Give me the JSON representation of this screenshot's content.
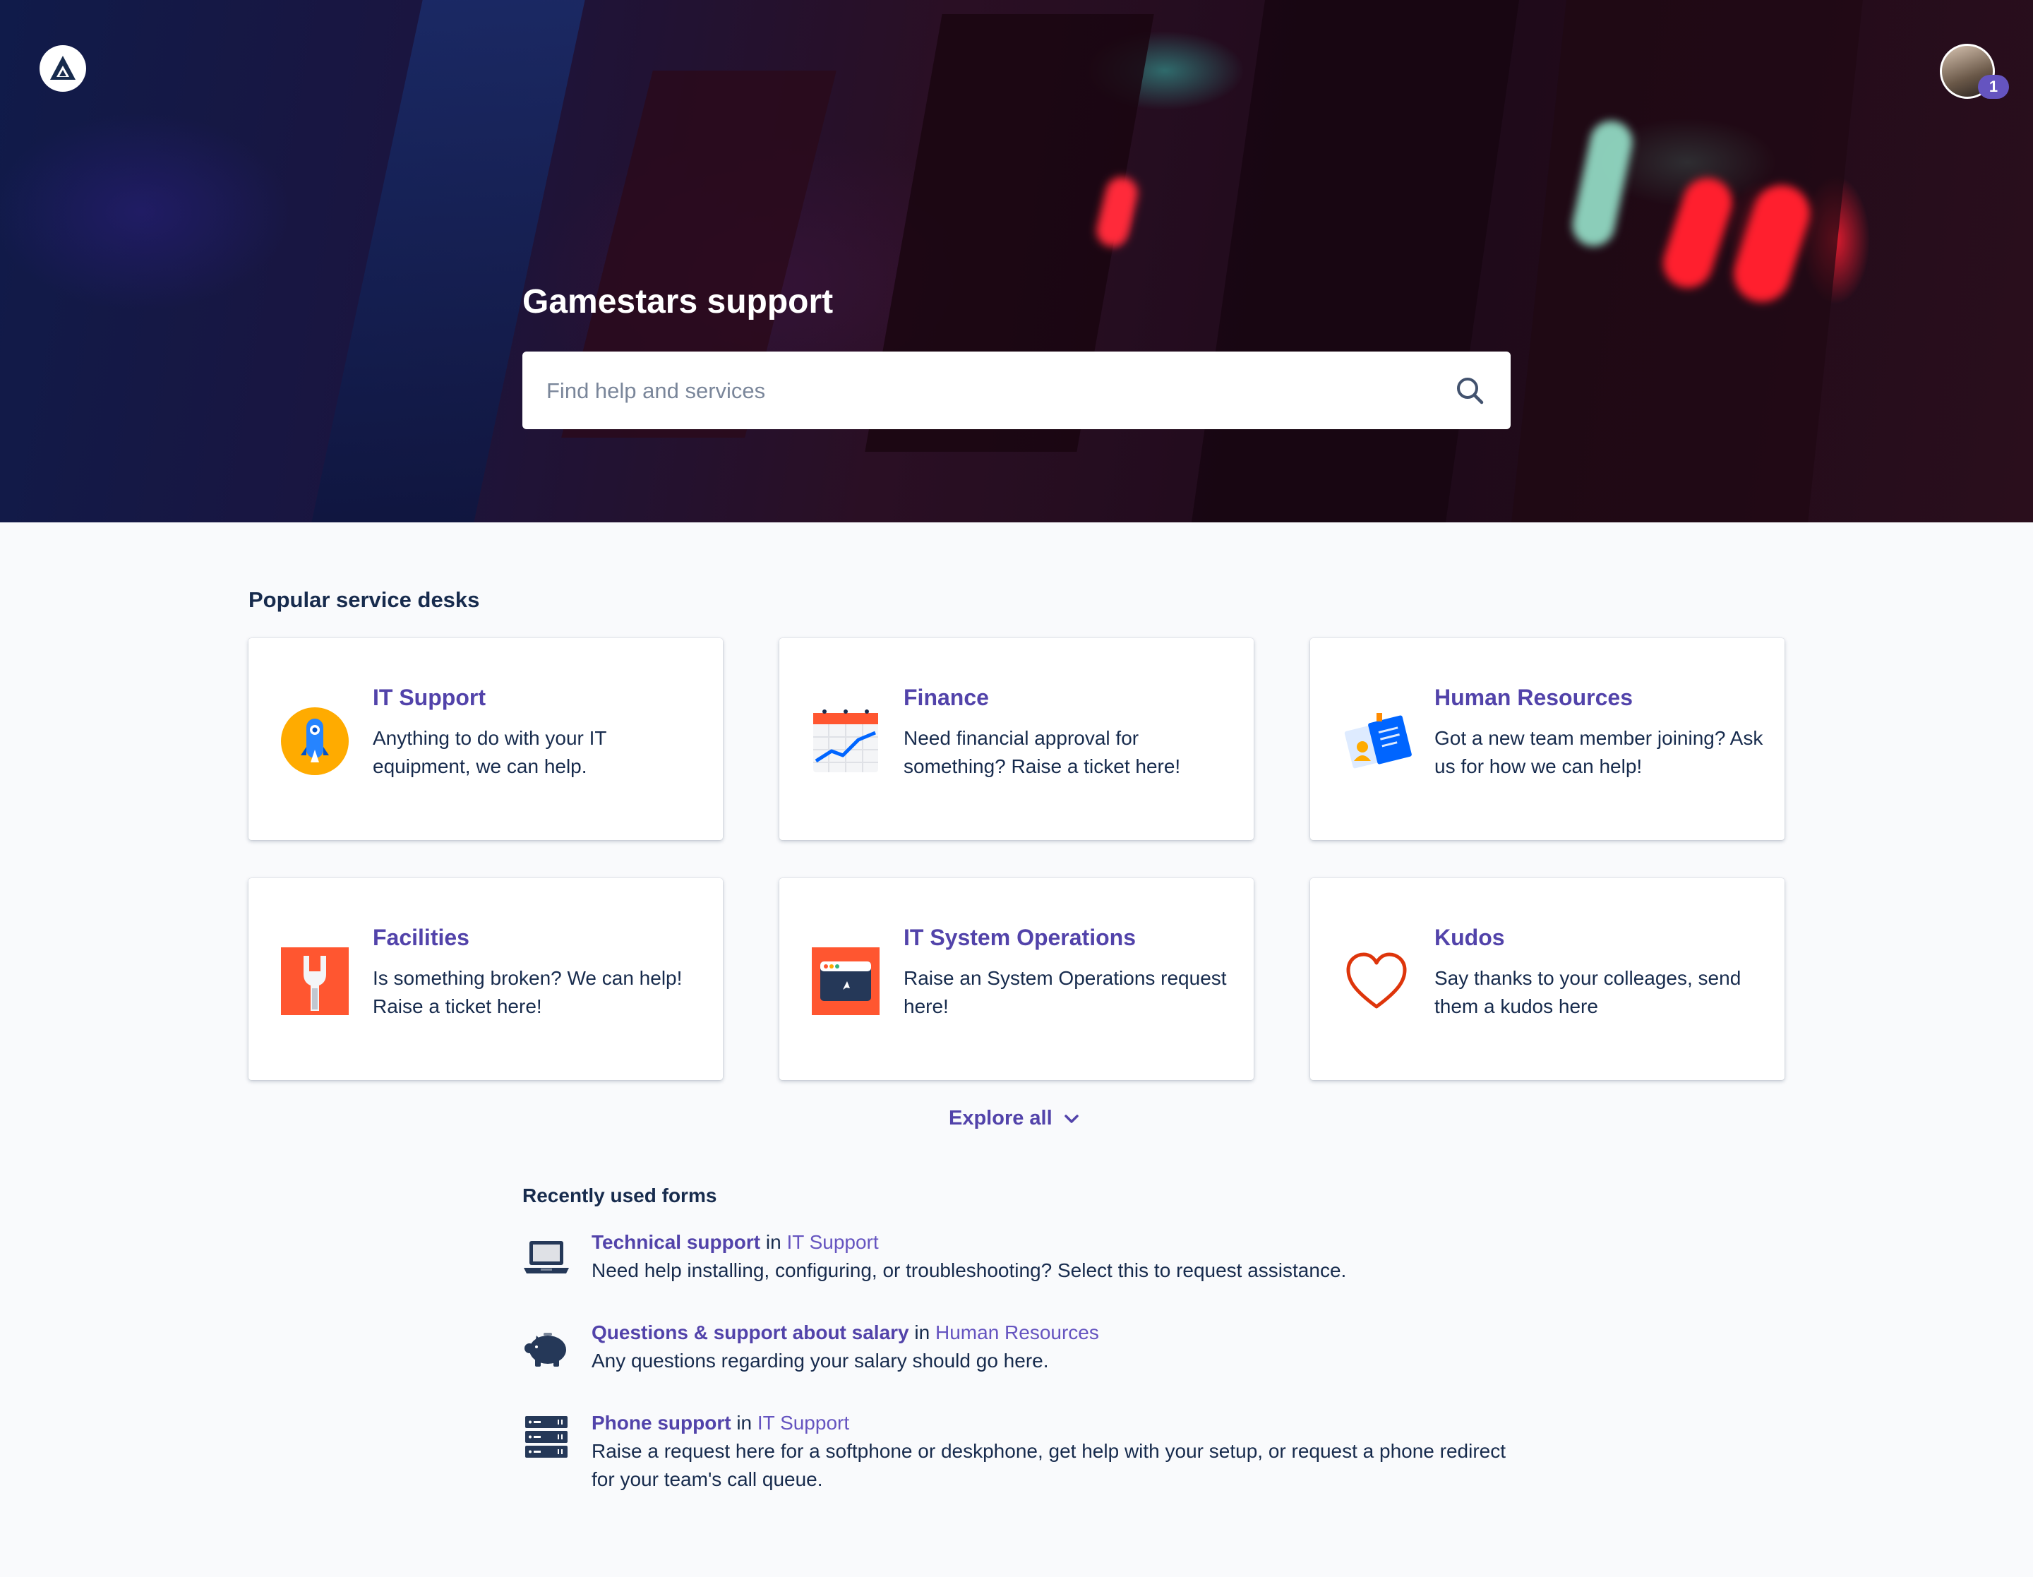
{
  "portal": {
    "title": "Gamestars support",
    "search_placeholder": "Find help and services",
    "notification_count": "1"
  },
  "popular": {
    "heading": "Popular service desks",
    "desks": [
      {
        "title": "IT Support",
        "description": "Anything to do with your IT equipment, we can help.",
        "icon": "rocket-icon"
      },
      {
        "title": "Finance",
        "description": "Need financial approval for something? Raise a ticket here!",
        "icon": "chart-calendar-icon"
      },
      {
        "title": "Human Resources",
        "description": "Got a new team member joining? Ask us for how we can help!",
        "icon": "id-cards-icon"
      },
      {
        "title": "Facilities",
        "description": "Is something broken? We can help! Raise a ticket here!",
        "icon": "wrench-icon"
      },
      {
        "title": "IT System Operations",
        "description": "Raise an System Operations request here!",
        "icon": "browser-window-icon"
      },
      {
        "title": "Kudos",
        "description": "Say thanks to your colleages, send them a kudos here",
        "icon": "heart-icon"
      }
    ],
    "explore_label": "Explore all"
  },
  "recent": {
    "heading": "Recently used forms",
    "in_word": "in",
    "items": [
      {
        "name": "Technical support",
        "desk": "IT Support",
        "description": "Need help installing, configuring, or troubleshooting? Select this to request assistance.",
        "icon": "laptop-icon"
      },
      {
        "name": "Questions & support about salary",
        "desk": "Human Resources",
        "description": "Any questions regarding your salary should go here.",
        "icon": "piggy-bank-icon"
      },
      {
        "name": "Phone support",
        "desk": "IT Support",
        "description": "Raise a request here for a softphone or deskphone, get help with your setup, or request a phone redirect for your team's call queue.",
        "icon": "server-icon"
      }
    ]
  },
  "colors": {
    "link": "#5243aa",
    "text": "#172b4d",
    "page_bg": "#f9fafc",
    "badge": "#6554c0"
  }
}
